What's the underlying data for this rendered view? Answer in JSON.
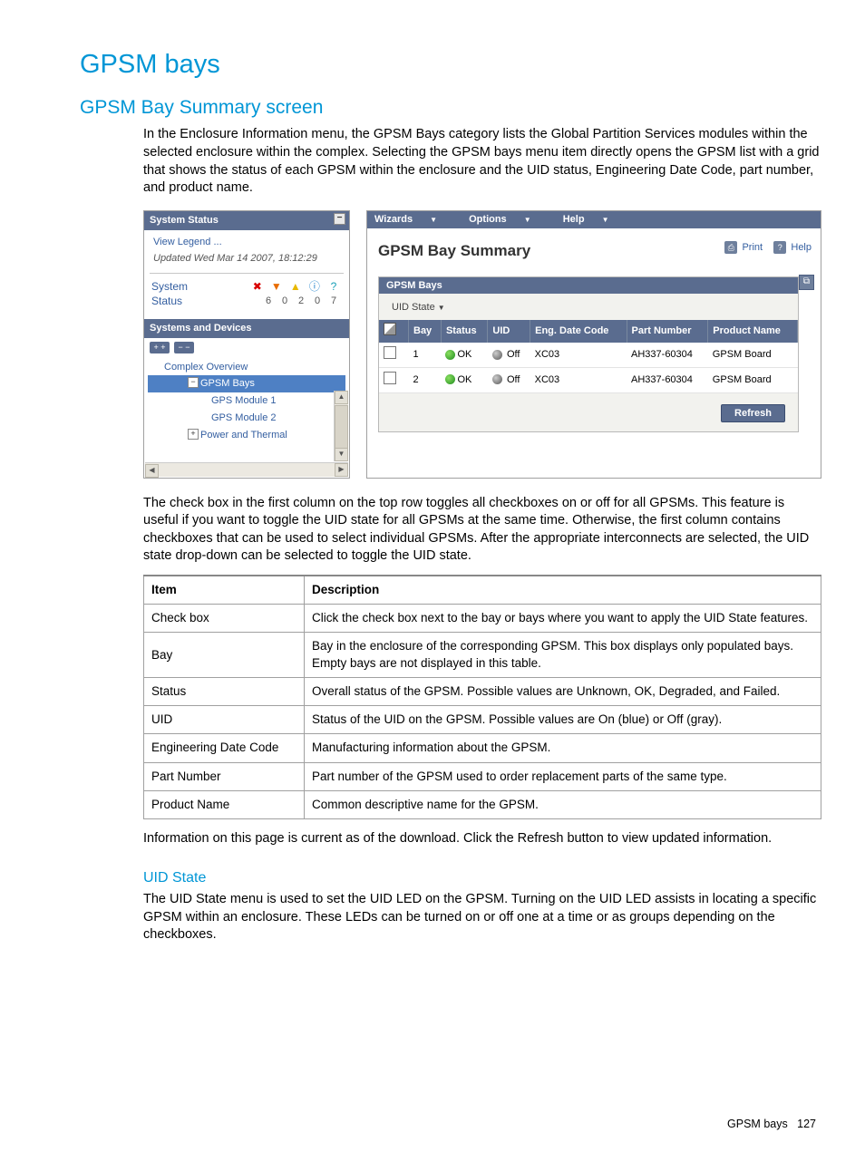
{
  "doc": {
    "h1": "GPSM bays",
    "h2": "GPSM Bay Summary screen",
    "intro": "In the Enclosure Information menu, the GPSM Bays category lists the Global Partition Services modules within the selected enclosure within the complex. Selecting the GPSM bays menu item directly opens the GPSM list with a grid that shows the status of each GPSM within the enclosure and the UID status, Engineering Date Code, part number, and product name.",
    "after_shot": "The check box in the first column on the top row toggles all checkboxes on or off for all GPSMs. This feature is useful if you want to toggle the UID state for all GPSMs at the same time. Otherwise, the first column contains checkboxes that can be used to select individual GPSMs. After the appropriate interconnects are selected, the UID state drop-down can be selected to toggle the UID state.",
    "table": {
      "headers": [
        "Item",
        "Description"
      ],
      "rows": [
        [
          "Check box",
          "Click the check box next to the bay or bays where you want to apply the UID State features."
        ],
        [
          "Bay",
          "Bay in the enclosure of the corresponding GPSM. This box displays only populated bays. Empty bays are not displayed in this table."
        ],
        [
          "Status",
          "Overall status of the GPSM. Possible values are Unknown, OK, Degraded, and Failed."
        ],
        [
          "UID",
          "Status of the UID on the GPSM. Possible values are On (blue) or Off (gray)."
        ],
        [
          "Engineering Date Code",
          "Manufacturing information about the GPSM."
        ],
        [
          "Part Number",
          "Part number of the GPSM used to order replacement parts of the same type."
        ],
        [
          "Product Name",
          "Common descriptive name for the GPSM."
        ]
      ]
    },
    "info_refresh_pre": "Information on this page is current as of the download. Click the ",
    "info_refresh_bold": "Refresh",
    "info_refresh_post": " button to view updated information.",
    "h3": "UID State",
    "uid_text": "The UID State menu is used to set the UID LED on the GPSM. Turning on the UID LED assists in locating a specific GPSM within an enclosure. These LEDs can be turned on or off one at a time or as groups depending on the checkboxes.",
    "footer_label": "GPSM bays",
    "footer_page": "127"
  },
  "app": {
    "side": {
      "hdr1": "System Status",
      "view_legend": "View Legend ...",
      "updated": "Updated Wed Mar 14 2007, 18:12:29",
      "status_label": "System Status",
      "counts": [
        "6",
        "0",
        "2",
        "0",
        "7"
      ],
      "hdr2": "Systems and Devices",
      "btn_expand": "+ +",
      "btn_collapse": "− −",
      "tree": {
        "overview": "Complex Overview",
        "gpsm_bays": "GPSM Bays",
        "mod1": "GPS Module 1",
        "mod2": "GPS Module 2",
        "power": "Power and Thermal"
      }
    },
    "main": {
      "menus": [
        "Wizards",
        "Options",
        "Help"
      ],
      "title": "GPSM Bay Summary",
      "print": "Print",
      "help": "Help",
      "panel_label": "GPSM Bays",
      "uid_state": "UID State",
      "cols": [
        "",
        "Bay",
        "Status",
        "UID",
        "Eng. Date Code",
        "Part Number",
        "Product Name"
      ],
      "rows": [
        {
          "bay": "1",
          "status": "OK",
          "uid": "Off",
          "edc": "XC03",
          "pn": "AH337-60304",
          "name": "GPSM Board"
        },
        {
          "bay": "2",
          "status": "OK",
          "uid": "Off",
          "edc": "XC03",
          "pn": "AH337-60304",
          "name": "GPSM Board"
        }
      ],
      "refresh": "Refresh"
    }
  }
}
